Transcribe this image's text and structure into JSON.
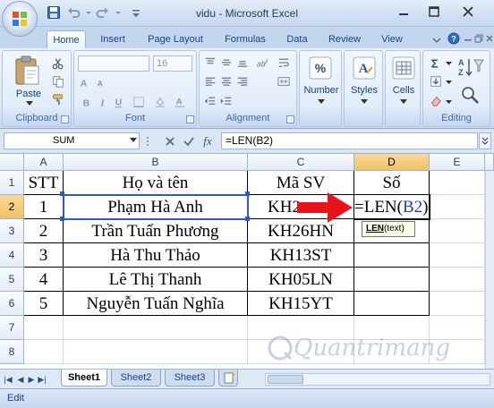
{
  "window": {
    "title": "vidu - Microsoft Excel"
  },
  "tabs": [
    "Home",
    "Insert",
    "Page Layout",
    "Formulas",
    "Data",
    "Review",
    "View"
  ],
  "ribbon": {
    "paste_label": "Paste",
    "font_size": "16",
    "number_label": "Number",
    "styles_label": "Styles",
    "cells_label": "Cells",
    "groups": {
      "clipboard": "Clipboard",
      "font": "Font",
      "alignment": "Alignment",
      "editing": "Editing"
    }
  },
  "formula_bar": {
    "name_box": "SUM",
    "fx": "fx",
    "formula": "=LEN(B2)"
  },
  "columns": [
    "A",
    "B",
    "C",
    "D",
    "E"
  ],
  "rows": [
    "1",
    "2",
    "3",
    "4",
    "5",
    "6",
    "7",
    "8"
  ],
  "table": {
    "headers": [
      "STT",
      "Họ và tên",
      "Mã SV",
      "Số"
    ],
    "rows": [
      [
        "1",
        "Phạm Hà Anh",
        "KH2"
      ],
      [
        "2",
        "Trần Tuấn Phương",
        "KH26HN"
      ],
      [
        "3",
        "Hà Thu Thảo",
        "KH13ST"
      ],
      [
        "4",
        "Lê Thị Thanh",
        "KH05LN"
      ],
      [
        "5",
        "Nguyễn Tuấn Nghĩa",
        "KH15YT"
      ]
    ]
  },
  "editing_cell": {
    "prefix": "=LEN(",
    "ref": "B2",
    "suffix": ")"
  },
  "tooltip": {
    "func": "LEN",
    "args": "(text)"
  },
  "sheets": [
    "Sheet1",
    "Sheet2",
    "Sheet3"
  ],
  "status": {
    "mode": "Edit"
  },
  "watermark": "Quantrimang",
  "colors": {
    "arrow": "#e8141c",
    "ref_blue": "#1f3fbf",
    "accent": "#15428b"
  }
}
